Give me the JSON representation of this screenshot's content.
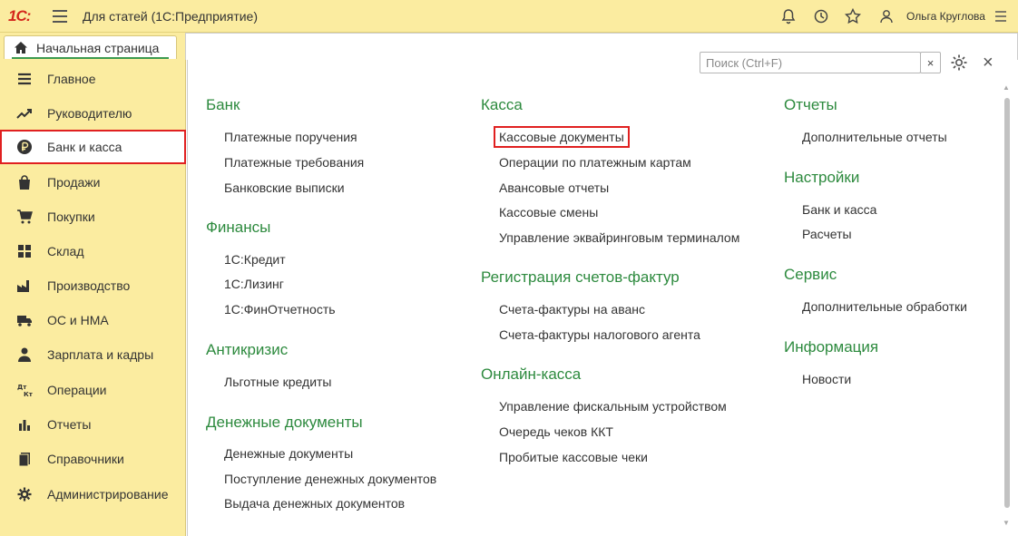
{
  "app": {
    "logo": "1С:",
    "title": "Для статей  (1С:Предприятие)",
    "user": "Ольга Круглова"
  },
  "titlebar_icons": [
    "bell-icon",
    "history-icon",
    "star-icon",
    "user-icon",
    "menu-lines-icon"
  ],
  "tabs": {
    "home_label": "Начальная страница"
  },
  "sidebar": {
    "items": [
      {
        "label": "Главное",
        "icon": "list-icon"
      },
      {
        "label": "Руководителю",
        "icon": "trend-up-icon"
      },
      {
        "label": "Банк и касса",
        "icon": "coin-icon",
        "active": true
      },
      {
        "label": "Продажи",
        "icon": "bag-icon"
      },
      {
        "label": "Покупки",
        "icon": "cart-icon"
      },
      {
        "label": "Склад",
        "icon": "grid-icon"
      },
      {
        "label": "Производство",
        "icon": "factory-icon"
      },
      {
        "label": "ОС и НМА",
        "icon": "truck-icon"
      },
      {
        "label": "Зарплата и кадры",
        "icon": "person-icon"
      },
      {
        "label": "Операции",
        "icon": "dt-kt-icon"
      },
      {
        "label": "Отчеты",
        "icon": "bar-chart-icon"
      },
      {
        "label": "Справочники",
        "icon": "book-icon"
      },
      {
        "label": "Администрирование",
        "icon": "gear-icon"
      }
    ]
  },
  "search": {
    "placeholder": "Поиск (Ctrl+F)",
    "clear": "×"
  },
  "columns": [
    {
      "sections": [
        {
          "title": "Банк",
          "links": [
            "Платежные поручения",
            "Платежные требования",
            "Банковские выписки"
          ]
        },
        {
          "title": "Финансы",
          "links": [
            "1С:Кредит",
            "1С:Лизинг",
            "1С:ФинОтчетность"
          ]
        },
        {
          "title": "Антикризис",
          "links": [
            "Льготные кредиты"
          ]
        },
        {
          "title": "Денежные документы",
          "links": [
            "Денежные документы",
            "Поступление денежных документов",
            "Выдача денежных документов"
          ]
        }
      ]
    },
    {
      "sections": [
        {
          "title": "Касса",
          "links": [
            "Кассовые документы",
            "Операции по платежным картам",
            "Авансовые отчеты",
            "Кассовые смены",
            "Управление эквайринговым терминалом"
          ]
        },
        {
          "title": "Регистрация счетов-фактур",
          "links": [
            "Счета-фактуры на аванс",
            "Счета-фактуры налогового агента"
          ]
        },
        {
          "title": "Онлайн-касса",
          "links": [
            "Управление фискальным устройством",
            "Очередь чеков ККТ",
            "Пробитые кассовые чеки"
          ]
        }
      ]
    },
    {
      "sections": [
        {
          "title": "Отчеты",
          "links": [
            "Дополнительные отчеты"
          ]
        },
        {
          "title": "Настройки",
          "links": [
            "Банк и касса",
            "Расчеты"
          ]
        },
        {
          "title": "Сервис",
          "links": [
            "Дополнительные обработки"
          ]
        },
        {
          "title": "Информация",
          "links": [
            "Новости"
          ]
        }
      ]
    }
  ],
  "colors": {
    "accent_green": "#2d8a3e",
    "highlight_red": "#e02020",
    "panel_yellow": "#fbeca0"
  }
}
